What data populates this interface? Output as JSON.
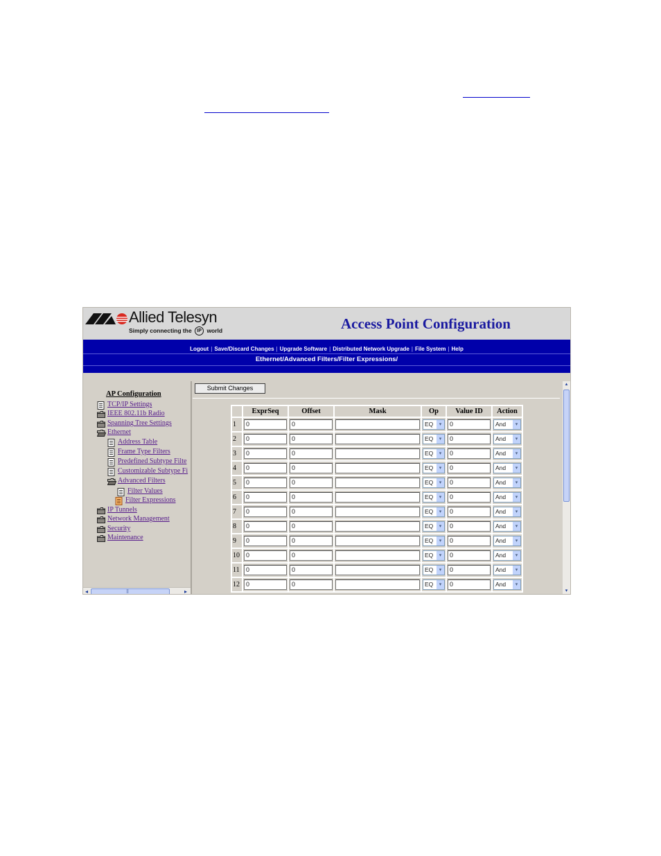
{
  "app": {
    "brand": "Allied Telesyn",
    "tagline_before": "Simply connecting the",
    "tagline_mark": "IP",
    "tagline_after": "world",
    "title": "Access Point Configuration"
  },
  "nav": {
    "links": [
      "Logout",
      "Save/Discard Changes",
      "Upgrade Software",
      "Distributed Network Upgrade",
      "File System",
      "Help"
    ],
    "separator": "|",
    "breadcrumb": "Ethernet/Advanced Filters/Filter Expressions/"
  },
  "tree": {
    "title": "AP Configuration",
    "items": [
      {
        "label": "TCP/IP Settings",
        "icon": "page-icon"
      },
      {
        "label": "IEEE 802.11b Radio",
        "icon": "folder-icon"
      },
      {
        "label": "Spanning Tree Settings",
        "icon": "folder-icon"
      },
      {
        "label": "Ethernet",
        "icon": "open-folder-icon"
      },
      {
        "label": "Address Table",
        "icon": "page-icon"
      },
      {
        "label": "Frame Type Filters",
        "icon": "page-icon"
      },
      {
        "label": "Predefined Subtype Filte",
        "icon": "page-icon"
      },
      {
        "label": "Customizable Subtype Fi",
        "icon": "page-icon"
      },
      {
        "label": "Advanced Filters",
        "icon": "open-folder-icon"
      },
      {
        "label": "Filter Values",
        "icon": "page-icon"
      },
      {
        "label": "Filter Expressions",
        "icon": "selected-page-icon"
      },
      {
        "label": "IP Tunnels",
        "icon": "folder-icon"
      },
      {
        "label": "Network Management",
        "icon": "folder-icon"
      },
      {
        "label": "Security",
        "icon": "folder-icon"
      },
      {
        "label": "Maintenance",
        "icon": "folder-icon"
      }
    ]
  },
  "form": {
    "submit_label": "Submit Changes",
    "columns": [
      "",
      "ExprSeq",
      "Offset",
      "Mask",
      "Op",
      "Value ID",
      "Action"
    ],
    "rows": [
      {
        "num": "1",
        "exprseq": "0",
        "offset": "0",
        "mask": "",
        "op": "EQ",
        "value_id": "0",
        "action": "And"
      },
      {
        "num": "2",
        "exprseq": "0",
        "offset": "0",
        "mask": "",
        "op": "EQ",
        "value_id": "0",
        "action": "And"
      },
      {
        "num": "3",
        "exprseq": "0",
        "offset": "0",
        "mask": "",
        "op": "EQ",
        "value_id": "0",
        "action": "And"
      },
      {
        "num": "4",
        "exprseq": "0",
        "offset": "0",
        "mask": "",
        "op": "EQ",
        "value_id": "0",
        "action": "And"
      },
      {
        "num": "5",
        "exprseq": "0",
        "offset": "0",
        "mask": "",
        "op": "EQ",
        "value_id": "0",
        "action": "And"
      },
      {
        "num": "6",
        "exprseq": "0",
        "offset": "0",
        "mask": "",
        "op": "EQ",
        "value_id": "0",
        "action": "And"
      },
      {
        "num": "7",
        "exprseq": "0",
        "offset": "0",
        "mask": "",
        "op": "EQ",
        "value_id": "0",
        "action": "And"
      },
      {
        "num": "8",
        "exprseq": "0",
        "offset": "0",
        "mask": "",
        "op": "EQ",
        "value_id": "0",
        "action": "And"
      },
      {
        "num": "9",
        "exprseq": "0",
        "offset": "0",
        "mask": "",
        "op": "EQ",
        "value_id": "0",
        "action": "And"
      },
      {
        "num": "10",
        "exprseq": "0",
        "offset": "0",
        "mask": "",
        "op": "EQ",
        "value_id": "0",
        "action": "And"
      },
      {
        "num": "11",
        "exprseq": "0",
        "offset": "0",
        "mask": "",
        "op": "EQ",
        "value_id": "0",
        "action": "And"
      },
      {
        "num": "12",
        "exprseq": "0",
        "offset": "0",
        "mask": "",
        "op": "EQ",
        "value_id": "0",
        "action": "And"
      }
    ]
  },
  "scrollbars": {
    "left": "◂",
    "right": "▸",
    "grip": "⦀",
    "up": "▴",
    "down": "▾"
  },
  "colors": {
    "navbar": "#0000aa",
    "title": "#1a1aa0",
    "link_visited": "#551a8b",
    "pane": "#d4d0c8"
  }
}
